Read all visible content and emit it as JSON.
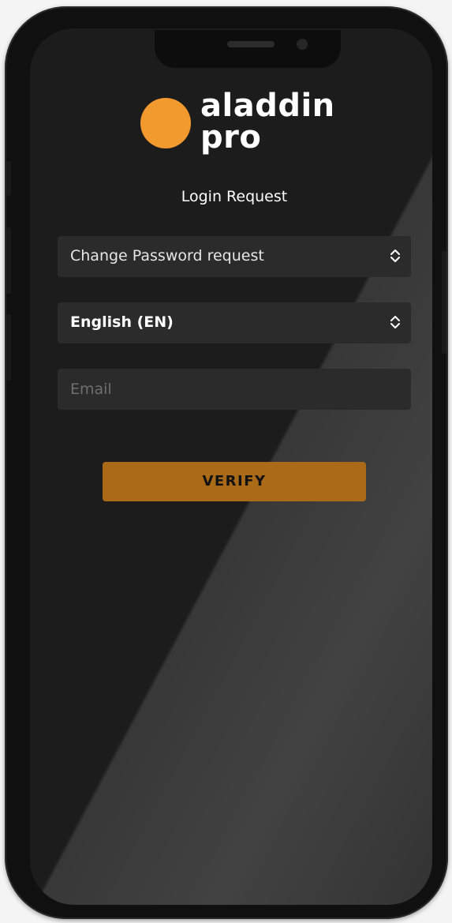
{
  "logo": {
    "line1": "aladdin",
    "line2": "pro"
  },
  "page": {
    "title": "Login Request"
  },
  "form": {
    "request_type": {
      "value": "Change Password request",
      "icon": "chevron-up-down-icon"
    },
    "language": {
      "value": "English (EN)",
      "icon": "chevron-up-down-icon"
    },
    "email": {
      "value": "",
      "placeholder": "Email"
    },
    "verify_label": "VERIFY"
  },
  "colors": {
    "brand_orange": "#f29a2e",
    "button": "#ab6a17",
    "screen_bg": "#1c1c1c",
    "field_bg": "#2b2b2b"
  }
}
